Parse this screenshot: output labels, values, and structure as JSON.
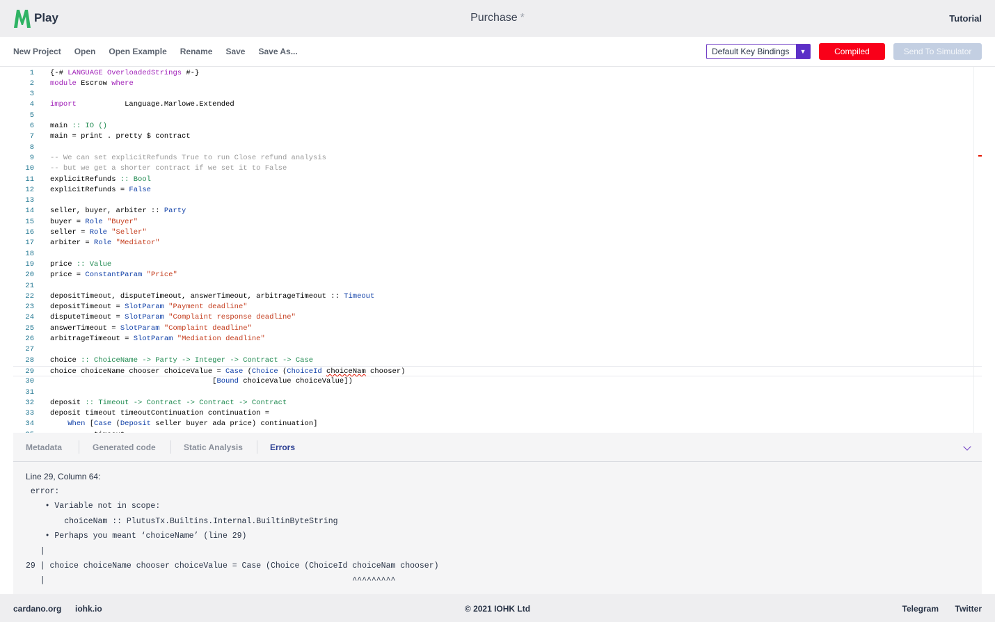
{
  "header": {
    "logo_text": "Play",
    "title": "Purchase",
    "dirty_marker": "*",
    "tutorial_label": "Tutorial",
    "brand_color": "#2fb364"
  },
  "toolbar": {
    "menu": [
      "New Project",
      "Open",
      "Open Example",
      "Rename",
      "Save",
      "Save As..."
    ],
    "key_bindings": "Default Key Bindings",
    "compiled_label": "Compiled",
    "send_label": "Send To Simulator",
    "compiled_color": "#f90019"
  },
  "editor": {
    "lines": [
      {
        "n": "1",
        "segs": [
          [
            "{-# ",
            ""
          ],
          [
            "LANGUAGE",
            "kw"
          ],
          [
            " ",
            ""
          ],
          [
            "OverloadedStrings",
            "kw"
          ],
          [
            " #-}",
            ""
          ]
        ]
      },
      {
        "n": "2",
        "segs": [
          [
            "module",
            "kw"
          ],
          [
            " Escrow ",
            ""
          ],
          [
            "where",
            "kw"
          ]
        ]
      },
      {
        "n": "3",
        "segs": []
      },
      {
        "n": "4",
        "segs": [
          [
            "import",
            "kw"
          ],
          [
            "           Language.Marlowe.Extended",
            ""
          ]
        ]
      },
      {
        "n": "5",
        "segs": []
      },
      {
        "n": "6",
        "segs": [
          [
            "main ",
            ""
          ],
          [
            ":: IO ()",
            "op"
          ]
        ]
      },
      {
        "n": "7",
        "segs": [
          [
            "main = print . pretty $ contract",
            ""
          ]
        ]
      },
      {
        "n": "8",
        "segs": []
      },
      {
        "n": "9",
        "segs": [
          [
            "-- We can set explicitRefunds True to run Close refund analysis",
            "cmt"
          ]
        ]
      },
      {
        "n": "10",
        "segs": [
          [
            "-- but we get a shorter contract if we set it to False",
            "cmt"
          ]
        ]
      },
      {
        "n": "11",
        "segs": [
          [
            "explicitRefunds ",
            ""
          ],
          [
            ":: Bool",
            "op"
          ]
        ]
      },
      {
        "n": "12",
        "segs": [
          [
            "explicitRefunds = ",
            ""
          ],
          [
            "False",
            "con"
          ]
        ]
      },
      {
        "n": "13",
        "segs": []
      },
      {
        "n": "14",
        "segs": [
          [
            "seller, buyer, arbiter :: ",
            ""
          ],
          [
            "Party",
            "con"
          ]
        ]
      },
      {
        "n": "15",
        "segs": [
          [
            "buyer = ",
            ""
          ],
          [
            "Role",
            "con"
          ],
          [
            " ",
            ""
          ],
          [
            "\"Buyer\"",
            "str"
          ]
        ]
      },
      {
        "n": "16",
        "segs": [
          [
            "seller = ",
            ""
          ],
          [
            "Role",
            "con"
          ],
          [
            " ",
            ""
          ],
          [
            "\"Seller\"",
            "str"
          ]
        ]
      },
      {
        "n": "17",
        "segs": [
          [
            "arbiter = ",
            ""
          ],
          [
            "Role",
            "con"
          ],
          [
            " ",
            ""
          ],
          [
            "\"Mediator\"",
            "str"
          ]
        ]
      },
      {
        "n": "18",
        "segs": []
      },
      {
        "n": "19",
        "segs": [
          [
            "price ",
            ""
          ],
          [
            ":: Value",
            "op"
          ]
        ]
      },
      {
        "n": "20",
        "segs": [
          [
            "price = ",
            ""
          ],
          [
            "ConstantParam",
            "con"
          ],
          [
            " ",
            ""
          ],
          [
            "\"Price\"",
            "str"
          ]
        ]
      },
      {
        "n": "21",
        "segs": []
      },
      {
        "n": "22",
        "segs": [
          [
            "depositTimeout, disputeTimeout, answerTimeout, arbitrageTimeout :: ",
            ""
          ],
          [
            "Timeout",
            "con"
          ]
        ]
      },
      {
        "n": "23",
        "segs": [
          [
            "depositTimeout = ",
            ""
          ],
          [
            "SlotParam",
            "con"
          ],
          [
            " ",
            ""
          ],
          [
            "\"Payment deadline\"",
            "str"
          ]
        ]
      },
      {
        "n": "24",
        "segs": [
          [
            "disputeTimeout = ",
            ""
          ],
          [
            "SlotParam",
            "con"
          ],
          [
            " ",
            ""
          ],
          [
            "\"Complaint response deadline\"",
            "str"
          ]
        ]
      },
      {
        "n": "25",
        "segs": [
          [
            "answerTimeout = ",
            ""
          ],
          [
            "SlotParam",
            "con"
          ],
          [
            " ",
            ""
          ],
          [
            "\"Complaint deadline\"",
            "str"
          ]
        ]
      },
      {
        "n": "26",
        "segs": [
          [
            "arbitrageTimeout = ",
            ""
          ],
          [
            "SlotParam",
            "con"
          ],
          [
            " ",
            ""
          ],
          [
            "\"Mediation deadline\"",
            "str"
          ]
        ]
      },
      {
        "n": "27",
        "segs": []
      },
      {
        "n": "28",
        "segs": [
          [
            "choice ",
            ""
          ],
          [
            ":: ChoiceName -> Party -> Integer -> Contract -> Case",
            "op"
          ]
        ]
      },
      {
        "n": "29",
        "segs": [
          [
            "choice choiceName chooser choiceValue = ",
            ""
          ],
          [
            "Case",
            "con"
          ],
          [
            " (",
            ""
          ],
          [
            "Choice",
            "con"
          ],
          [
            " (",
            ""
          ],
          [
            "ChoiceId",
            "con"
          ],
          [
            " ",
            ""
          ],
          [
            "choiceNam",
            "sq"
          ],
          [
            " chooser)",
            ""
          ]
        ]
      },
      {
        "n": "30",
        "segs": [
          [
            "                                     [",
            ""
          ],
          [
            "Bound",
            "con"
          ],
          [
            " choiceValue choiceValue])",
            ""
          ]
        ]
      },
      {
        "n": "31",
        "segs": []
      },
      {
        "n": "32",
        "segs": [
          [
            "deposit ",
            ""
          ],
          [
            ":: Timeout -> Contract -> Contract -> Contract",
            "op"
          ]
        ]
      },
      {
        "n": "33",
        "segs": [
          [
            "deposit timeout timeoutContinuation continuation =",
            ""
          ]
        ]
      },
      {
        "n": "34",
        "segs": [
          [
            "    ",
            ""
          ],
          [
            "When",
            "con"
          ],
          [
            " [",
            ""
          ],
          [
            "Case",
            "con"
          ],
          [
            " (",
            ""
          ],
          [
            "Deposit",
            "con"
          ],
          [
            " seller buyer ada price) continuation]",
            ""
          ]
        ]
      },
      {
        "n": "35",
        "segs": [
          [
            "    ",
            ""
          ],
          [
            "      timeout",
            ""
          ]
        ]
      }
    ]
  },
  "panel": {
    "tabs": [
      "Metadata",
      "Generated code",
      "Static Analysis",
      "Errors"
    ],
    "active_tab": "Errors",
    "error_position": "Line 29, Column 64:",
    "error_lines": [
      " error:",
      "    • Variable not in scope:",
      "        choiceNam :: PlutusTx.Builtins.Internal.BuiltinByteString",
      "    • Perhaps you meant ‘choiceName’ (line 29)",
      "   |",
      "29 | choice choiceName chooser choiceValue = Case (Choice (ChoiceId choiceNam chooser)",
      "   |                                                                ^^^^^^^^^"
    ]
  },
  "footer": {
    "left": [
      "cardano.org",
      "iohk.io"
    ],
    "copyright": "© 2021 IOHK Ltd",
    "right": [
      "Telegram",
      "Twitter"
    ]
  }
}
